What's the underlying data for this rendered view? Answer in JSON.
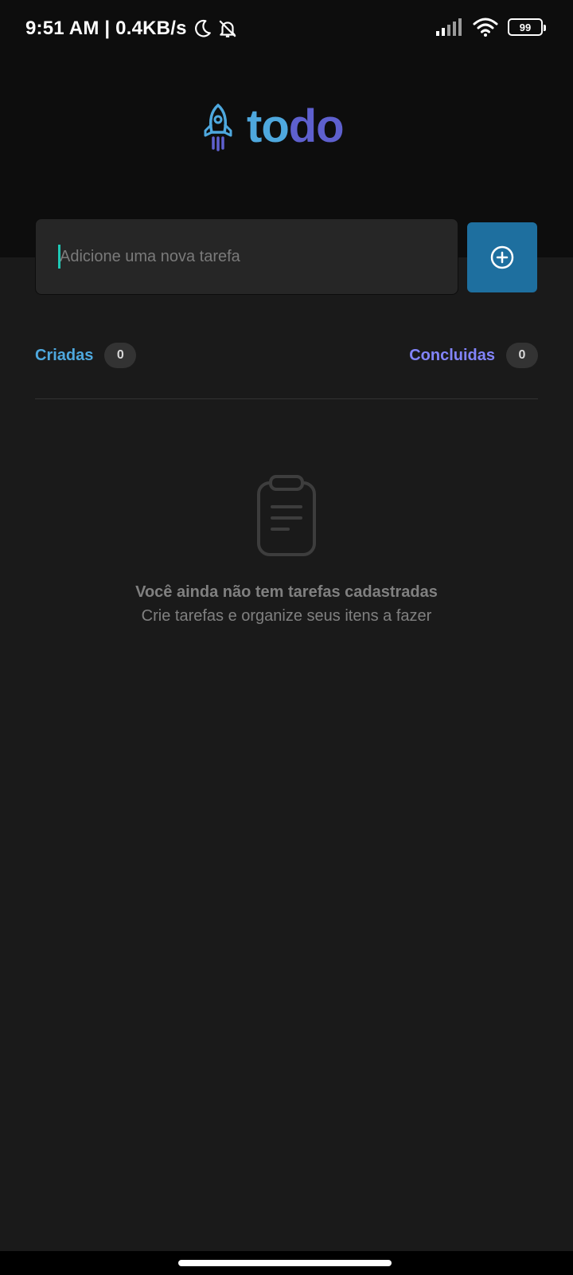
{
  "status_bar": {
    "time_speed": "9:51 AM | 0.4KB/s",
    "battery": "99",
    "icons": [
      "moon-icon",
      "bell-off-icon",
      "signal-icon",
      "wifi-icon",
      "battery-icon"
    ]
  },
  "logo": {
    "part1": "to",
    "part2": "do",
    "icon": "rocket-icon",
    "colors": {
      "part1": "#4ea8de",
      "part2": "#5e60ce"
    }
  },
  "task_form": {
    "placeholder": "Adicione uma nova tarefa",
    "value": "",
    "add_icon": "plus-circle-icon",
    "button_color": "#1e6f9f"
  },
  "counters": {
    "created_label": "Criadas",
    "created_count": "0",
    "done_label": "Concluidas",
    "done_count": "0"
  },
  "empty_state": {
    "icon": "clipboard-icon",
    "title": "Você ainda não tem tarefas cadastradas",
    "subtitle": "Crie tarefas e organize seus itens a fazer"
  }
}
